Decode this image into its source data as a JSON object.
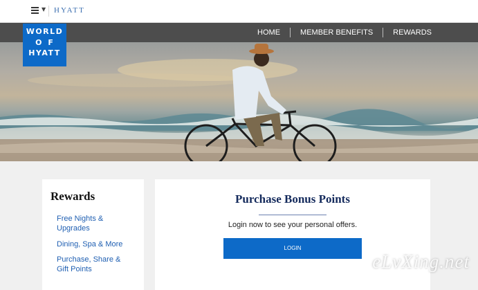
{
  "header": {
    "brand": "HYATT",
    "menu_icon": "hamburger-icon"
  },
  "nav": {
    "items": [
      {
        "label": "HOME"
      },
      {
        "label": "MEMBER BENEFITS"
      },
      {
        "label": "REWARDS"
      }
    ]
  },
  "logo": {
    "lines": [
      "WORLD",
      "OF",
      "HYATT"
    ]
  },
  "sidebar": {
    "title": "Rewards",
    "links": [
      {
        "label": "Free Nights & Upgrades"
      },
      {
        "label": "Dining, Spa & More"
      },
      {
        "label": "Purchase, Share & Gift Points"
      }
    ]
  },
  "main": {
    "title": "Purchase Bonus Points",
    "message": "Login now to see your personal offers.",
    "login_label": "LOGIN"
  },
  "watermark": "eLvXing.net",
  "colors": {
    "accent": "#0d6ac8",
    "nav_bg": "#4d4d4d",
    "link": "#1f5fb2",
    "title": "#142a5c"
  }
}
